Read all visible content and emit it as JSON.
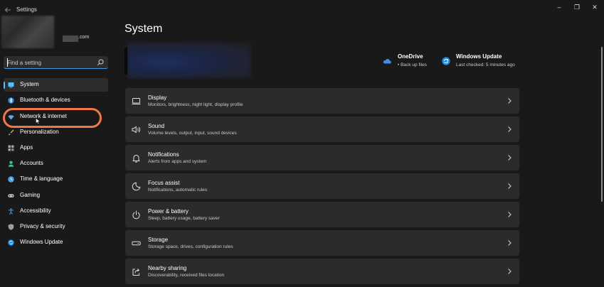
{
  "window": {
    "title": "Settings",
    "back_icon": "back-arrow-icon",
    "controls": [
      "minimize-icon",
      "maximize-icon",
      "close-icon"
    ],
    "minimize_glyph": "–",
    "maximize_glyph": "❐",
    "close_glyph": "✕"
  },
  "profile": {
    "email_suffix": ".com"
  },
  "search": {
    "placeholder": "Find a setting",
    "icon": "search-icon"
  },
  "sidebar": {
    "items": [
      {
        "label": "System",
        "icon": "system-icon",
        "color": "#4cc2ff",
        "active": true
      },
      {
        "label": "Bluetooth & devices",
        "icon": "bluetooth-icon",
        "color": "#2f8ad8"
      },
      {
        "label": "Network & internet",
        "icon": "network-icon",
        "color": "#5aa9e6"
      },
      {
        "label": "Personalization",
        "icon": "brush-icon",
        "color": "#e5a34a"
      },
      {
        "label": "Apps",
        "icon": "apps-icon",
        "color": "#9aa4b8"
      },
      {
        "label": "Accounts",
        "icon": "person-icon",
        "color": "#3fbf9f"
      },
      {
        "label": "Time & language",
        "icon": "globe-clock-icon",
        "color": "#4ea5e8"
      },
      {
        "label": "Gaming",
        "icon": "gamepad-icon",
        "color": "#b9c2cf"
      },
      {
        "label": "Accessibility",
        "icon": "accessibility-icon",
        "color": "#3ea0ee"
      },
      {
        "label": "Privacy & security",
        "icon": "shield-icon",
        "color": "#9aa0aa"
      },
      {
        "label": "Windows Update",
        "icon": "update-icon",
        "color": "#1f8fe6"
      }
    ]
  },
  "main": {
    "title": "System",
    "status": [
      {
        "title": "OneDrive",
        "subtitle": "• Back up files",
        "icon": "onedrive-cloud-icon",
        "color": "#3a8fe8"
      },
      {
        "title": "Windows Update",
        "subtitle": "Last checked: 5 minutes ago",
        "icon": "windows-update-icon",
        "color": "#1f8fe6"
      }
    ],
    "cards": [
      {
        "title": "Display",
        "subtitle": "Monitors, brightness, night light, display profile",
        "icon": "monitor-icon"
      },
      {
        "title": "Sound",
        "subtitle": "Volume levels, output, input, sound devices",
        "icon": "speaker-icon"
      },
      {
        "title": "Notifications",
        "subtitle": "Alerts from apps and system",
        "icon": "bell-icon"
      },
      {
        "title": "Focus assist",
        "subtitle": "Notifications, automatic rules",
        "icon": "moon-icon"
      },
      {
        "title": "Power & battery",
        "subtitle": "Sleep, battery usage, battery saver",
        "icon": "power-icon"
      },
      {
        "title": "Storage",
        "subtitle": "Storage space, drives, configuration rules",
        "icon": "storage-drive-icon"
      },
      {
        "title": "Nearby sharing",
        "subtitle": "Discoverability, received files location",
        "icon": "share-icon"
      }
    ]
  },
  "colors": {
    "background": "#191919",
    "card": "#2b2b2b",
    "accent": "#4cc2ff",
    "highlight_annotation": "#f07848"
  }
}
